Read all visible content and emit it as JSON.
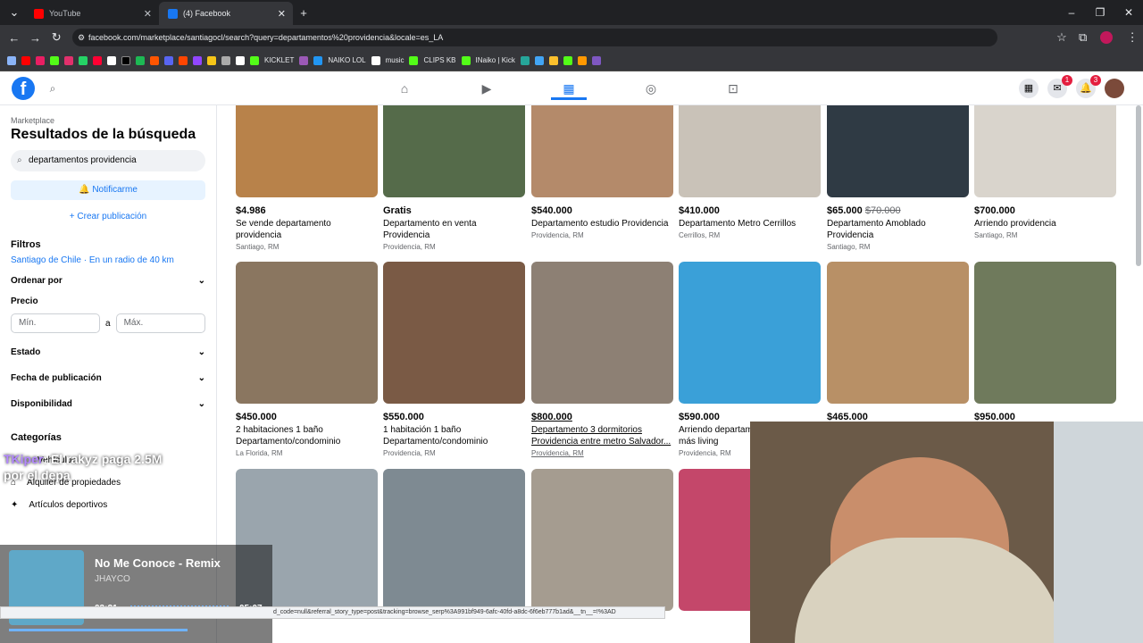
{
  "browser": {
    "tabs": [
      {
        "title": "YouTube",
        "color": "#ff0000"
      },
      {
        "title": "(4) Facebook",
        "color": "#1877f2"
      }
    ],
    "url": "facebook.com/marketplace/santiagocl/search?query=departamentos%20providencia&locale=es_LA",
    "bookmarks": [
      "KICKLET",
      "NAIKO LOL",
      "music",
      "CLIPS KB",
      "INaiko | Kick"
    ]
  },
  "fb": {
    "messenger_badge": "1",
    "notif_badge": "3"
  },
  "sidebar": {
    "breadcrumb": "Marketplace",
    "title": "Resultados de la búsqueda",
    "search_value": "departamentos providencia",
    "notify_label": "Notificarme",
    "create_label": "+ Crear publicación",
    "filters_title": "Filtros",
    "location": "Santiago de Chile · En un radio de 40 km",
    "sort_label": "Ordenar por",
    "price_label": "Precio",
    "min_placeholder": "Mín.",
    "max_placeholder": "Máx.",
    "price_sep": "a",
    "state_label": "Estado",
    "date_label": "Fecha de publicación",
    "availability_label": "Disponibilidad",
    "categories_title": "Categorías",
    "categories": [
      "Vehículos",
      "Alquiler de propiedades",
      "Artículos deportivos"
    ]
  },
  "listings": [
    {
      "price": "$4.986",
      "title": "Se vende departamento providencia",
      "location": "Santiago, RM",
      "color": "#b8824a"
    },
    {
      "price": "Gratis",
      "title": "Departamento en venta Providencia",
      "location": "Providencia, RM",
      "color": "#556b4a"
    },
    {
      "price": "$540.000",
      "title": "Departamento estudio Providencia",
      "location": "Providencia, RM",
      "color": "#b48a6a"
    },
    {
      "price": "$410.000",
      "title": "Departamento Metro Cerrillos",
      "location": "Cerrillos, RM",
      "color": "#c9c2b8"
    },
    {
      "price": "$65.000",
      "old_price": "$70.000",
      "title": "Departamento Amoblado Providencia",
      "location": "Santiago, RM",
      "color": "#2f3a44"
    },
    {
      "price": "$700.000",
      "title": "Arriendo providencia",
      "location": "Santiago, RM",
      "color": "#d9d4cc"
    },
    {
      "price": "$450.000",
      "title": "2 habitaciones 1 baño Departamento/condominio",
      "location": "La Florida, RM",
      "color": "#8a7660"
    },
    {
      "price": "$550.000",
      "title": "1 habitación 1 baño Departamento/condominio",
      "location": "Providencia, RM",
      "color": "#7a5a45"
    },
    {
      "price": "$800.000",
      "title": "Departamento 3 dormitorios Providencia entre metro Salvador...",
      "location": "Providencia, RM",
      "color": "#8d8074"
    },
    {
      "price": "$590.000",
      "title": "Arriendo departamento habitación más living",
      "location": "Providencia, RM",
      "color": "#3aa0d8"
    },
    {
      "price": "$465.000",
      "title": "",
      "location": "",
      "color": "#b89066"
    },
    {
      "price": "$950.000",
      "title": "",
      "location": "",
      "color": "#6f7a5c"
    },
    {
      "color": "#9aa5ad"
    },
    {
      "color": "#7e8a92"
    },
    {
      "color": "#a59c90"
    },
    {
      "color": "#c4476a"
    }
  ],
  "overlay": {
    "chat_user": "TKiper",
    "chat_message": ": El rakyz paga 2.5M por el depa",
    "song_title": "No Me Conoce - Remix",
    "artist": "JHAYCO",
    "elapsed": "03:21",
    "duration": "05:07",
    "status_url": "d_code=null&referral_story_type=post&tracking=browse_serp%3A991bf949-6afc-40fd-a8dc-6f6eb777b1ad&__tn__=!%3AD"
  }
}
